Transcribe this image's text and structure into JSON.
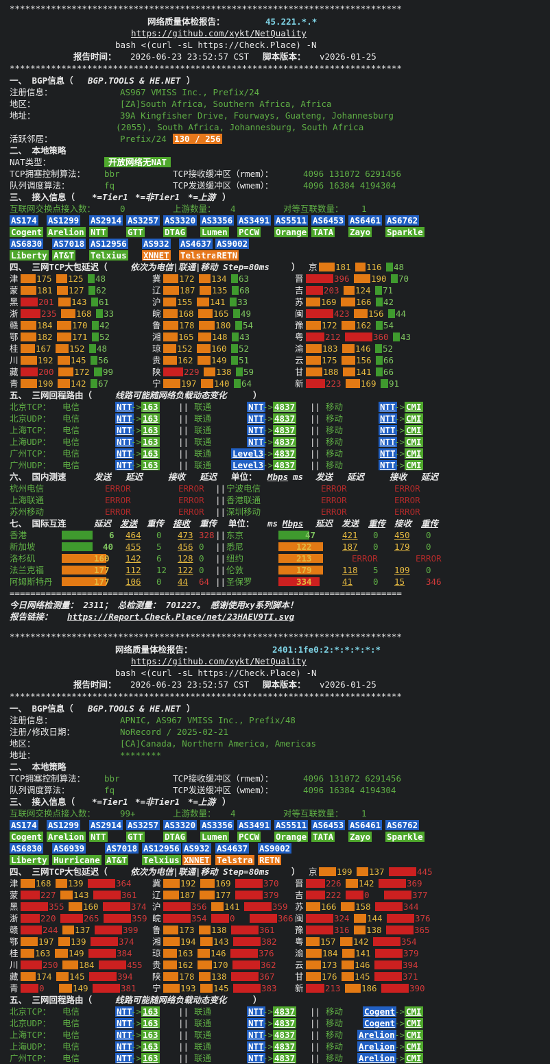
{
  "report1": {
    "stars": "****************************************************************************",
    "title": "网络质量体检报告：",
    "ip": "45.221.*.*",
    "url": "https://github.com/xykt/NetQuality",
    "cmd": "bash <(curl -sL https://Check.Place) -N",
    "time_label": "报告时间：",
    "time": "2026-06-23 23:52:57 CST",
    "ver_label": "脚本版本：",
    "ver": "v2026-01-25",
    "s1": "一、 BGP信息（",
    "s1b": "BGP.TOOLS & HE.NET",
    "s1c": "）",
    "bgp": [
      {
        "k": "注册信息：",
        "v": "AS967 VMISS Inc., Prefix/24"
      },
      {
        "k": "地区：",
        "v": "[ZA]South Africa, Southern Africa, Africa"
      },
      {
        "k": "地址：",
        "v": "39A Kingfisher Drive, Fourways, Guateng, Johannesburg"
      },
      {
        "k": "",
        "v": "(2055), South Africa, Johannesburg, South Africa"
      }
    ],
    "neighbor_label": "活跃邻居：",
    "neighbor_prefix": "Prefix/24",
    "neighbor_badge": "130 / 256",
    "s2": "二、 本地策略",
    "nat_label": "NAT类型：",
    "nat_value": "开放网络无NAT",
    "tcp_cc_label": "TCP拥塞控制算法：",
    "tcp_cc": "bbr",
    "rmem_label": "TCP接收缓冲区（rmem）：",
    "rmem": "4096 131072 6291456",
    "qdisc_label": "队列调度算法：",
    "qdisc": "fq",
    "wmem_label": "TCP发送缓冲区（wmem）：",
    "wmem": "4096 16384 4194304",
    "s3": "三、 接入信息（",
    "s3a": "*=Tier1",
    "s3b": "*=非Tier1",
    "s3c": "*=上游",
    "s3d": "）",
    "ix_label": "互联网交换点接入数：",
    "ix": "0",
    "up_label": "上游数量：",
    "up": "4",
    "peer_label": "对等互联数量：",
    "peer": "1",
    "asn_row1": [
      "AS174",
      "AS1299",
      "AS2914",
      "AS3257",
      "AS3320",
      "AS3356",
      "AS3491",
      "AS5511",
      "AS6453",
      "AS6461",
      "AS6762"
    ],
    "name_row1": [
      "Cogent",
      "Arelion",
      "NTT",
      "GTT",
      "DTAG",
      "Lumen",
      "PCCW",
      "Orange",
      "TATA",
      "Zayo",
      "Sparkle"
    ],
    "asn_row2": [
      "AS6830",
      "AS7018",
      "AS12956",
      "AS932",
      "AS4637",
      "AS9002"
    ],
    "name_row2": [
      "Liberty",
      "AT&T",
      "Telxius",
      "XNNET",
      "Telstra",
      "RETN"
    ],
    "s4": "四、 三网TCP大包延迟（",
    "s4b": "依次为电信|联通|移动 Step=80ms",
    "s4c": "）",
    "bj": {
      "n": "京",
      "v": [
        "181",
        "116",
        "48"
      ]
    },
    "lat": [
      [
        [
          "津",
          "175",
          "125",
          "48"
        ],
        [
          "冀",
          "172",
          "134",
          "63"
        ],
        [
          "晋",
          "396",
          "190",
          "70"
        ]
      ],
      [
        [
          "蒙",
          "181",
          "127",
          "62"
        ],
        [
          "辽",
          "187",
          "135",
          "68"
        ],
        [
          "吉",
          "203",
          "124",
          "71"
        ]
      ],
      [
        [
          "黑",
          "201",
          "143",
          "61"
        ],
        [
          "沪",
          "155",
          "141",
          "33"
        ],
        [
          "苏",
          "169",
          "166",
          "42"
        ]
      ],
      [
        [
          "浙",
          "235",
          "168",
          "33"
        ],
        [
          "皖",
          "168",
          "165",
          "49"
        ],
        [
          "闽",
          "423",
          "156",
          "44"
        ]
      ],
      [
        [
          "赣",
          "184",
          "170",
          "42"
        ],
        [
          "鲁",
          "178",
          "180",
          "54"
        ],
        [
          "豫",
          "172",
          "162",
          "54"
        ]
      ],
      [
        [
          "鄂",
          "182",
          "171",
          "52"
        ],
        [
          "湘",
          "165",
          "148",
          "43"
        ],
        [
          "粤",
          "212",
          "360",
          "43"
        ]
      ],
      [
        [
          "桂",
          "167",
          "152",
          "48"
        ],
        [
          "琼",
          "152",
          "160",
          "52"
        ],
        [
          "渝",
          "183",
          "146",
          "52"
        ]
      ],
      [
        [
          "川",
          "192",
          "145",
          "56"
        ],
        [
          "贵",
          "162",
          "149",
          "51"
        ],
        [
          "云",
          "175",
          "156",
          "66"
        ]
      ],
      [
        [
          "藏",
          "200",
          "172",
          "99"
        ],
        [
          "陕",
          "229",
          "138",
          "59"
        ],
        [
          "甘",
          "188",
          "141",
          "66"
        ]
      ],
      [
        [
          "青",
          "190",
          "142",
          "67"
        ],
        [
          "宁",
          "197",
          "140",
          "64"
        ],
        [
          "新",
          "223",
          "169",
          "91"
        ]
      ]
    ],
    "s5": "五、 三网回程路由（",
    "s5b": "线路可能随网络负载动态变化",
    "s5c": "）",
    "routes": [
      [
        "北京TCP：",
        "电信",
        "NTT",
        "163",
        "联通",
        "NTT",
        "4837",
        "移动",
        "NTT",
        "CMI"
      ],
      [
        "北京UDP：",
        "电信",
        "NTT",
        "163",
        "联通",
        "NTT",
        "4837",
        "移动",
        "NTT",
        "CMI"
      ],
      [
        "上海TCP：",
        "电信",
        "NTT",
        "163",
        "联通",
        "NTT",
        "4837",
        "移动",
        "NTT",
        "CMI"
      ],
      [
        "上海UDP：",
        "电信",
        "NTT",
        "163",
        "联通",
        "NTT",
        "4837",
        "移动",
        "NTT",
        "CMI"
      ],
      [
        "广州TCP：",
        "电信",
        "NTT",
        "163",
        "联通",
        "Level3",
        "4837",
        "移动",
        "NTT",
        "CMI"
      ],
      [
        "广州UDP：",
        "电信",
        "NTT",
        "163",
        "联通",
        "Level3",
        "4837",
        "移动",
        "NTT",
        "CMI"
      ]
    ],
    "s6": "六、 国内测速",
    "s6h": [
      "发送",
      "延迟",
      "接收",
      "延迟",
      "单位：",
      "Mbps",
      "ms",
      "发送",
      "延迟",
      "接收",
      "延迟"
    ],
    "dom": [
      [
        "杭州电信",
        "宁波电信"
      ],
      [
        "上海联通",
        "香港联通"
      ],
      [
        "苏州移动",
        "深圳移动"
      ]
    ],
    "err": "ERROR",
    "s7": "七、 国际互连",
    "s7h": [
      "延迟",
      "发送",
      "重传",
      "接收",
      "重传",
      "单位：",
      "ms",
      "Mbps",
      "延迟",
      "发送",
      "重传",
      "接收",
      "重传"
    ],
    "intl": [
      [
        [
          "香港",
          "6",
          "464",
          "0",
          "473",
          "328"
        ],
        [
          "东京",
          "47",
          "421",
          "0",
          "450",
          "0"
        ]
      ],
      [
        [
          "新加坡",
          "40",
          "455",
          "5",
          "456",
          "0"
        ],
        [
          "悉尼",
          "122",
          "187",
          "0",
          "179",
          "0"
        ]
      ],
      [
        [
          "洛杉矶",
          "160",
          "142",
          "6",
          "128",
          "0"
        ],
        [
          "纽约",
          "213",
          "ERROR",
          "",
          "ERROR",
          ""
        ]
      ],
      [
        [
          "法兰克福",
          "177",
          "112",
          "12",
          "122",
          "0"
        ],
        [
          "伦敦",
          "179",
          "118",
          "5",
          "109",
          "0"
        ]
      ],
      [
        [
          "阿姆斯特丹",
          "177",
          "106",
          "0",
          "44",
          "64"
        ],
        [
          "圣保罗",
          "334",
          "41",
          "0",
          "15",
          "346"
        ]
      ]
    ],
    "eqline": "============================================================================",
    "footer1": "今日网络检测量： 2311； 总检测量： 701227。 感谢使用xy系列脚本！",
    "footer2_label": "报告链接：",
    "footer2": "https://Report.Check.Place/net/23HAEV9TI.svg"
  },
  "report2": {
    "title": "网络质量体检报告：",
    "ip": "2401:1fe0:2:*:*:*:*:*",
    "s1": "一、 BGP信息（",
    "s1b": "BGP.TOOLS & HE.NET",
    "s1c": "）",
    "bgp": [
      {
        "k": "注册信息：",
        "v": "APNIC, AS967 VMISS Inc., Prefix/48"
      },
      {
        "k": "注册/修改日期：",
        "v": "NoRecord / 2025-02-21"
      },
      {
        "k": "地区：",
        "v": "[CA]Canada, Northern America, Americas"
      },
      {
        "k": "地址：",
        "v": "********"
      }
    ],
    "ix": "99+",
    "up": "4",
    "peer": "1",
    "asn_row2": [
      "AS6830",
      "AS6939",
      "AS7018",
      "AS12956",
      "AS932",
      "AS4637",
      "AS9002"
    ],
    "name_row2": [
      "Liberty",
      "Hurricane",
      "AT&T",
      "Telxius",
      "XNNET",
      "Telstra",
      "RETN"
    ],
    "bj": {
      "n": "京",
      "v": [
        "199",
        "137",
        "445"
      ]
    },
    "lat": [
      [
        [
          "津",
          "168",
          "139",
          "364"
        ],
        [
          "冀",
          "192",
          "169",
          "370"
        ],
        [
          "晋",
          "226",
          "142",
          "369"
        ]
      ],
      [
        [
          "蒙",
          "227",
          "143",
          "361"
        ],
        [
          "辽",
          "187",
          "177",
          "379"
        ],
        [
          "吉",
          "222",
          "0",
          "377"
        ]
      ],
      [
        [
          "黑",
          "355",
          "160",
          "374"
        ],
        [
          "沪",
          "356",
          "141",
          "359"
        ],
        [
          "苏",
          "166",
          "158",
          "344"
        ]
      ],
      [
        [
          "浙",
          "220",
          "265",
          "359"
        ],
        [
          "皖",
          "354",
          "0",
          "366"
        ],
        [
          "闽",
          "324",
          "144",
          "376"
        ]
      ],
      [
        [
          "赣",
          "244",
          "137",
          "399"
        ],
        [
          "鲁",
          "173",
          "138",
          "361"
        ],
        [
          "豫",
          "316",
          "138",
          "365"
        ]
      ],
      [
        [
          "鄂",
          "197",
          "139",
          "374"
        ],
        [
          "湘",
          "194",
          "143",
          "382"
        ],
        [
          "粤",
          "157",
          "142",
          "354"
        ]
      ],
      [
        [
          "桂",
          "163",
          "149",
          "384"
        ],
        [
          "琼",
          "163",
          "146",
          "376"
        ],
        [
          "渝",
          "184",
          "141",
          "379"
        ]
      ],
      [
        [
          "川",
          "250",
          "184",
          "455"
        ],
        [
          "贵",
          "162",
          "170",
          "362"
        ],
        [
          "云",
          "173",
          "146",
          "394"
        ]
      ],
      [
        [
          "藏",
          "174",
          "145",
          "394"
        ],
        [
          "陕",
          "178",
          "138",
          "367"
        ],
        [
          "甘",
          "176",
          "145",
          "371"
        ]
      ],
      [
        [
          "青",
          "0",
          "149",
          "381"
        ],
        [
          "宁",
          "193",
          "145",
          "383"
        ],
        [
          "新",
          "213",
          "186",
          "390"
        ]
      ]
    ],
    "routes": [
      [
        "北京TCP：",
        "电信",
        "NTT",
        "163",
        "联通",
        "NTT",
        "4837",
        "移动",
        "Cogent",
        "CMI"
      ],
      [
        "北京UDP：",
        "电信",
        "NTT",
        "163",
        "联通",
        "NTT",
        "4837",
        "移动",
        "Cogent",
        "CMI"
      ],
      [
        "上海TCP：",
        "电信",
        "NTT",
        "163",
        "联通",
        "NTT",
        "4837",
        "移动",
        "Arelion",
        "CMI"
      ],
      [
        "上海UDP：",
        "电信",
        "NTT",
        "163",
        "联通",
        "NTT",
        "4837",
        "移动",
        "Arelion",
        "CMI"
      ],
      [
        "广州TCP：",
        "电信",
        "NTT",
        "163",
        "联通",
        "NTT",
        "4837",
        "移动",
        "Arelion",
        "CMI"
      ]
    ]
  },
  "colors": {
    "bg": "#1d1f21",
    "green": "#5fae45",
    "red": "#d23a3a",
    "orange": "#e37a14",
    "blue": "#2160c4",
    "cyan": "#7fd4e6"
  }
}
